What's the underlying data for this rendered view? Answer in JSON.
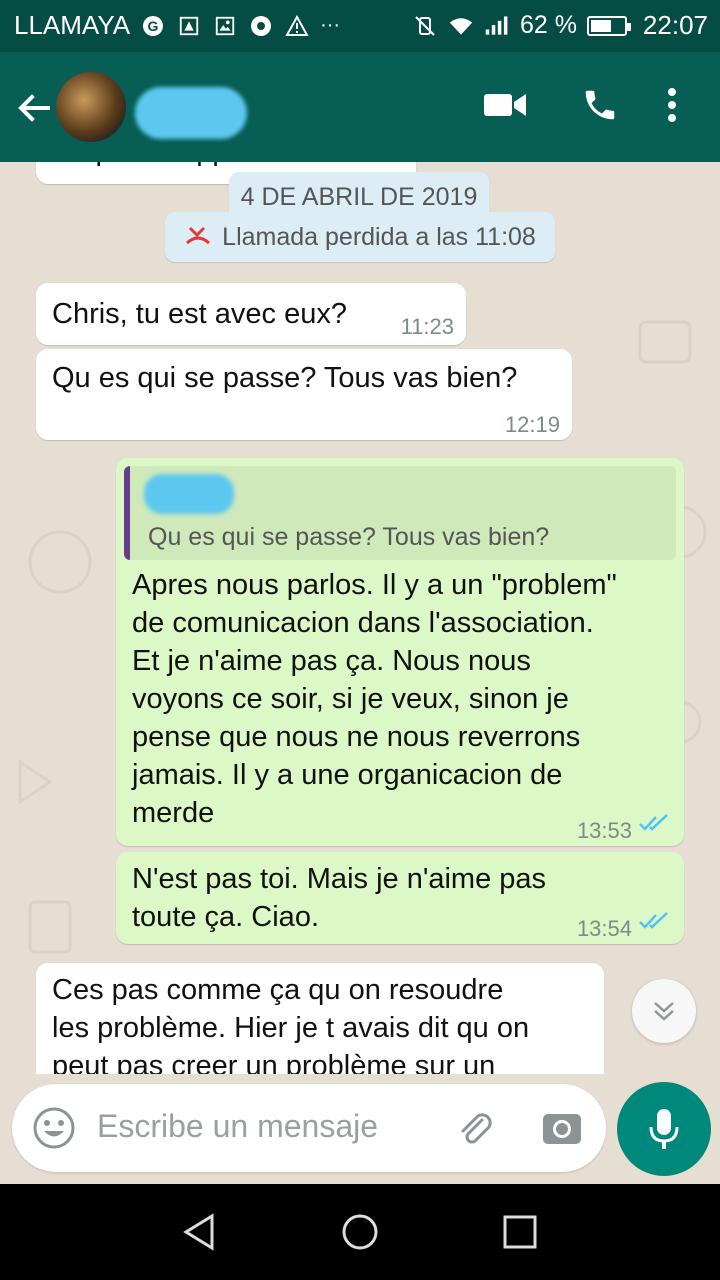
{
  "status_bar": {
    "carrier": "LLAMAYA",
    "battery": "62 %",
    "battery_level": 0.62,
    "time": "22:07",
    "overflow": "···"
  },
  "header": {
    "back_icon": "arrow-left-icon",
    "video_icon": "video-call-icon",
    "call_icon": "phone-icon",
    "menu_icon": "more-vert-icon"
  },
  "chat": {
    "date_chip": "4 DE ABRIL DE 2019",
    "missed_call": "Llamada perdida a las 11:08",
    "partial_prev": "Se peux t'appeler?",
    "messages": [
      {
        "text": "Chris, tu est avec eux?",
        "time": "11:23"
      },
      {
        "text": "Qu es qui se passe? Tous vas bien?",
        "time": "12:19"
      },
      {
        "quote": "Qu es qui se passe? Tous vas bien?",
        "lines": [
          "Apres nous parlos. Il y a un \"problem\"",
          "de comunicacion dans l'association.",
          "Et je n'aime pas ça. Nous nous",
          "voyons ce soir, si je veux, sinon je",
          "pense que nous ne nous reverrons",
          "jamais. Il y a une organicacion de",
          "merde"
        ],
        "time": "13:53"
      },
      {
        "lines": [
          "N'est pas toi. Mais je n'aime pas",
          "toute ça. Ciao."
        ],
        "time": "13:54"
      },
      {
        "lines": [
          "Ces pas comme ça qu on resoudre",
          "les problème. Hier je t avais dit qu on",
          "peut pas creer un problème sur un"
        ]
      }
    ]
  },
  "composer": {
    "placeholder": "Escribe un mensaje"
  }
}
